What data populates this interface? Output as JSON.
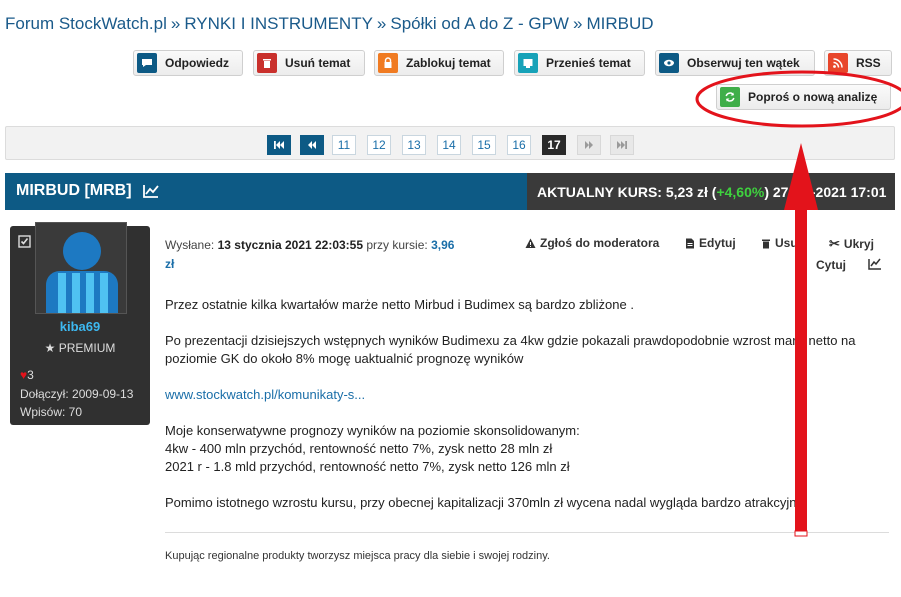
{
  "breadcrumb": {
    "items": [
      "Forum StockWatch.pl",
      "RYNKI I INSTRUMENTY",
      "Spółki od A do Z - GPW",
      "MIRBUD"
    ],
    "separator": "»"
  },
  "toolbar": {
    "reply": {
      "label": "Odpowiedz",
      "icon": "speech-bubble-icon",
      "color": "#0d5a85"
    },
    "delete": {
      "label": "Usuń temat",
      "icon": "trash-icon",
      "color": "#c9302c"
    },
    "lock": {
      "label": "Zablokuj temat",
      "icon": "lock-icon",
      "color": "#f07b22"
    },
    "move": {
      "label": "Przenieś temat",
      "icon": "move-icon",
      "color": "#17a2b8"
    },
    "watch": {
      "label": "Obserwuj ten wątek",
      "icon": "eye-icon",
      "color": "#0d5a85"
    },
    "rss": {
      "label": "RSS",
      "icon": "rss-icon",
      "color": "#e8462b"
    },
    "request_analysis": {
      "label": "Poproś o nową analizę",
      "icon": "refresh-icon",
      "color": "#3fae49"
    }
  },
  "pagination": {
    "pages": [
      "11",
      "12",
      "13",
      "14",
      "15",
      "16"
    ],
    "current": "17"
  },
  "topic": {
    "title": "MIRBUD [MRB]",
    "price_label": "AKTUALNY KURS: 5,23 zł (",
    "price_change": "+4,60%",
    "price_suffix": ") 27-0",
    "price_tail": "-2021 17:01"
  },
  "user": {
    "name": "kiba69",
    "rank": "PREMIUM",
    "likes": "3",
    "joined": "Dołączył: 2009-09-13",
    "posts": "Wpisów: 70"
  },
  "post_meta": {
    "sent_label": "Wysłane:",
    "sent_date": "13 stycznia 2021 22:03:55",
    "price_label": "przy kursie:",
    "price_value": "3,96",
    "price_unit": "zł"
  },
  "post_actions": {
    "report": "Zgłoś do moderatora",
    "edit": "Edytuj",
    "delete": "Usu",
    "hide": "Ukryj",
    "quote": "Cytuj"
  },
  "post": {
    "p1": "Przez ostatnie kilka kwartałów marże netto Mirbud i Budimex są bardzo zbliżone .",
    "p2a": "Po prezentacji dzisiejszych wstępnych wyników Budimexu za 4kw gdzie pokazali prawdopodobnie wzrost mar",
    "p2b": "netto na",
    "p2c": "poziomie GK do około 8% mogę uaktualnić prognozę wyników",
    "link": "www.stockwatch.pl/komunikaty-s...",
    "p4a": "Moje konserwatywne prognozy wyników na poziomie skonsolidowanym:",
    "p4b": "4kw - 400 mln przychód, rentowność netto 7%, zysk netto 28 mln zł",
    "p4c": "2021 r - 1.8 mld przychód, rentowność netto 7%, zysk netto 126 mln zł",
    "p5": "Pomimo istotnego wzrostu kursu, przy obecnej kapitalizacji 370mln zł wycena nadal wygląda bardzo atrakcyjn",
    "signature": "Kupując regionalne produkty tworzysz miejsca pracy dla siebie i swojej rodziny."
  },
  "annotation": {
    "color": "#e3131b"
  }
}
